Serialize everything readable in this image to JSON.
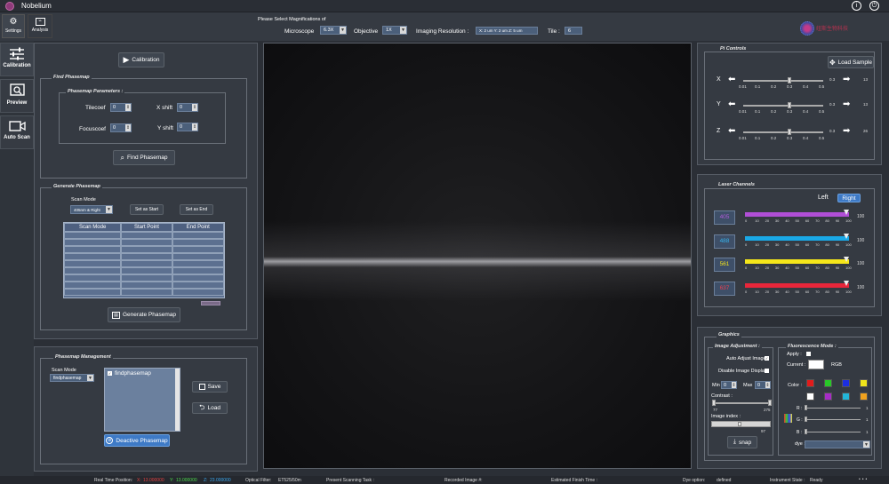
{
  "app": {
    "title": "Nobelium"
  },
  "toolbar": {
    "settings_label": "Settings",
    "analysis_label": "Analysis",
    "magnification_prompt": "Please Select Magnifications of",
    "microscope_label": "Microscope",
    "microscope_value": "6.3X",
    "objective_label": "Objective",
    "objective_value": "1X",
    "imaging_resolution_label": "Imaging Resolution :",
    "imaging_resolution_value": "X: 2 um Y: 2 um Z: 5 um",
    "tile_label": "Tile :",
    "tile_value": "6",
    "logo_text": "纽斯生物科技"
  },
  "sidebar": {
    "calibration": "Calibration",
    "preview": "Preview",
    "auto_scan": "Auto Scan"
  },
  "left": {
    "calibration_button": "Calibration",
    "find_phasemap": {
      "title": "Find Phasemap",
      "params_title": "Phasemap Parameters :",
      "tilecoef_label": "Tilecoef",
      "tilecoef_value": "0",
      "focuscoef_label": "Focuscoef",
      "focuscoef_value": "0",
      "xshift_label": "X shift",
      "xshift_value": "0",
      "yshift_label": "Y shift",
      "yshift_value": "0",
      "button": "Find Phasemap"
    },
    "generate_phasemap": {
      "title": "Generate Phasemap",
      "scan_mode_label": "Scan Mode",
      "scan_mode_value": "405nm & Right",
      "set_start": "Set as Start",
      "set_end": "Set as End",
      "columns": [
        "Scan Mode",
        "Start Point",
        "End Point"
      ],
      "button": "Generate Phasemap"
    },
    "management": {
      "title": "Phasemap Management",
      "scan_mode_label": "Scan Mode",
      "scan_mode_value": "findphasemap",
      "list_items": [
        "findphasemap"
      ],
      "save": "Save",
      "load": "Load",
      "deactive": "Deactive Phasemap"
    }
  },
  "pi_controls": {
    "title": "Pi  Controls",
    "load_sample": "Load Sample",
    "ticks": [
      "0.01",
      "0.1",
      "0.2",
      "0.3",
      "0.4",
      "0.5"
    ],
    "axes": [
      {
        "name": "X",
        "value": "13",
        "step": "0.3"
      },
      {
        "name": "Y",
        "value": "13",
        "step": "0.3"
      },
      {
        "name": "Z",
        "value": "26",
        "step": "0.3"
      }
    ]
  },
  "laser_channels": {
    "title": "Laser Channels",
    "left": "Left",
    "right": "Right",
    "ticks": [
      "0",
      "10",
      "20",
      "30",
      "40",
      "50",
      "60",
      "70",
      "80",
      "90",
      "100"
    ],
    "channels": [
      {
        "name": "405",
        "value": "100",
        "color": "#b04ed6",
        "label_color": "#b05ad8"
      },
      {
        "name": "488",
        "value": "100",
        "color": "#1aa8e6",
        "label_color": "#36b1ea"
      },
      {
        "name": "561",
        "value": "100",
        "color": "#f5e61a",
        "label_color": "#f2e21c"
      },
      {
        "name": "637",
        "value": "100",
        "color": "#e8263a",
        "label_color": "#e84050"
      }
    ]
  },
  "graphics": {
    "title": "Graphics",
    "image_adjustment": {
      "title": "Image Adjustment :",
      "auto_adjust": "Auto Adjust Image",
      "disable_display": "Disable Image Display",
      "min_label": "Min",
      "min_value": "0",
      "max_label": "Max",
      "max_value": "0",
      "contrast_label": "Contrast :",
      "contrast_min": "77",
      "contrast_max": "275",
      "image_index_label": "Image index :",
      "image_index_max": "97",
      "snap": "snap"
    },
    "fluorescence": {
      "title": "Fluorescence Mode :",
      "apply_label": "Apply :",
      "current_label": "Current :",
      "current_value": "RGB",
      "color_label": "Color :",
      "colors": [
        "#e21b1b",
        "#28c928",
        "#1c2ee0",
        "#f1e51b",
        "#ffffff",
        "#a62cc7",
        "#22b5d8",
        "#f0a21e"
      ],
      "r_label": "R :",
      "g_label": "G :",
      "b_label": "B :",
      "r_value": "1",
      "g_value": "1",
      "b_value": "1",
      "dye_label": "dye :"
    }
  },
  "status": {
    "realtime_label": "Real Time Position:",
    "x_label": "X:",
    "x_value": "13.000000",
    "y_label": "Y:",
    "y_value": "13.000000",
    "z_label": "Z:",
    "z_value": "23.000000",
    "optical_filter_label": "Optical Filter:",
    "optical_filter_value": "ET525/50m",
    "present_task_label": "Present Scanning Task :",
    "recorded_label": "Recorded Image #:",
    "finish_label": "Estimated Finish Time :",
    "dye_label": "Dye option:",
    "dye_value": "defined",
    "instrument_label": "Instrument State :",
    "instrument_value": "Ready"
  }
}
